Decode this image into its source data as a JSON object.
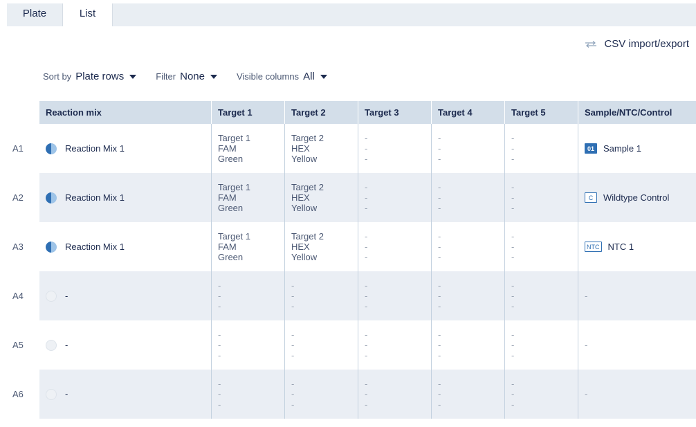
{
  "tabs": {
    "plate": "Plate",
    "list": "List"
  },
  "csv_label": "CSV import/export",
  "controls": {
    "sort_label": "Sort by",
    "sort_value": "Plate rows",
    "filter_label": "Filter",
    "filter_value": "None",
    "columns_label": "Visible columns",
    "columns_value": "All"
  },
  "headers": [
    "Reaction mix",
    "Target 1",
    "Target 2",
    "Target 3",
    "Target 4",
    "Target 5",
    "Sample/NTC/Control"
  ],
  "colors": {
    "header_bg": "#d3dee9",
    "row_shaded": "#eaeef4",
    "accent": "#2f6fb3"
  },
  "rows": [
    {
      "well": "A1",
      "mix": "Reaction Mix 1",
      "mix_icon": "filled",
      "t1": [
        "Target 1",
        "FAM",
        "Green"
      ],
      "t2": [
        "Target 2",
        "HEX",
        "Yellow"
      ],
      "t3": [
        "-",
        "-",
        "-"
      ],
      "t4": [
        "-",
        "-",
        "-"
      ],
      "t5": [
        "-",
        "-",
        "-"
      ],
      "badge": "01",
      "badge_style": "solid",
      "sample": "Sample 1"
    },
    {
      "well": "A2",
      "mix": "Reaction Mix 1",
      "mix_icon": "filled",
      "t1": [
        "Target 1",
        "FAM",
        "Green"
      ],
      "t2": [
        "Target 2",
        "HEX",
        "Yellow"
      ],
      "t3": [
        "-",
        "-",
        "-"
      ],
      "t4": [
        "-",
        "-",
        "-"
      ],
      "t5": [
        "-",
        "-",
        "-"
      ],
      "badge": "C",
      "badge_style": "outline",
      "sample": "Wildtype Control"
    },
    {
      "well": "A3",
      "mix": "Reaction Mix 1",
      "mix_icon": "filled",
      "t1": [
        "Target 1",
        "FAM",
        "Green"
      ],
      "t2": [
        "Target 2",
        "HEX",
        "Yellow"
      ],
      "t3": [
        "-",
        "-",
        "-"
      ],
      "t4": [
        "-",
        "-",
        "-"
      ],
      "t5": [
        "-",
        "-",
        "-"
      ],
      "badge": "NTC",
      "badge_style": "outline",
      "sample": "NTC 1"
    },
    {
      "well": "A4",
      "mix": "-",
      "mix_icon": "empty",
      "t1": [
        "-",
        "-",
        "-"
      ],
      "t2": [
        "-",
        "-",
        "-"
      ],
      "t3": [
        "-",
        "-",
        "-"
      ],
      "t4": [
        "-",
        "-",
        "-"
      ],
      "t5": [
        "-",
        "-",
        "-"
      ],
      "badge": "",
      "badge_style": "none",
      "sample": "-"
    },
    {
      "well": "A5",
      "mix": "-",
      "mix_icon": "empty",
      "t1": [
        "-",
        "-",
        "-"
      ],
      "t2": [
        "-",
        "-",
        "-"
      ],
      "t3": [
        "-",
        "-",
        "-"
      ],
      "t4": [
        "-",
        "-",
        "-"
      ],
      "t5": [
        "-",
        "-",
        "-"
      ],
      "badge": "",
      "badge_style": "none",
      "sample": "-"
    },
    {
      "well": "A6",
      "mix": "-",
      "mix_icon": "empty",
      "t1": [
        "-",
        "-",
        "-"
      ],
      "t2": [
        "-",
        "-",
        "-"
      ],
      "t3": [
        "-",
        "-",
        "-"
      ],
      "t4": [
        "-",
        "-",
        "-"
      ],
      "t5": [
        "-",
        "-",
        "-"
      ],
      "badge": "",
      "badge_style": "none",
      "sample": "-"
    }
  ]
}
